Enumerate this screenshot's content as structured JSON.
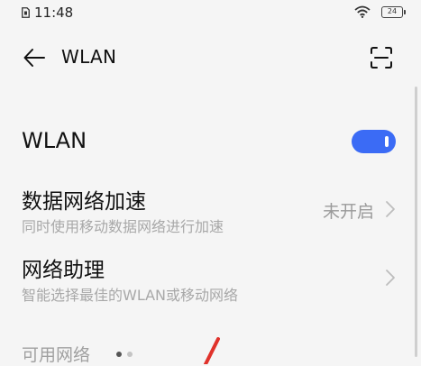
{
  "status_bar": {
    "time": "11:48",
    "battery": "24",
    "icons": [
      "sim-card-icon",
      "wifi-icon",
      "battery-icon"
    ]
  },
  "header": {
    "title": "WLAN",
    "back_icon": "back-arrow-icon",
    "scan_icon": "scan-icon"
  },
  "wlan_row": {
    "label": "WLAN",
    "toggle_on": true,
    "accent_color": "#3b6bf5"
  },
  "settings": [
    {
      "title": "数据网络加速",
      "subtitle": "同时使用移动数据网络进行加速",
      "value": "未开启"
    },
    {
      "title": "网络助理",
      "subtitle": "智能选择最佳的WLAN或移动网络",
      "value": ""
    }
  ],
  "available_networks": {
    "header": "可用网络"
  }
}
